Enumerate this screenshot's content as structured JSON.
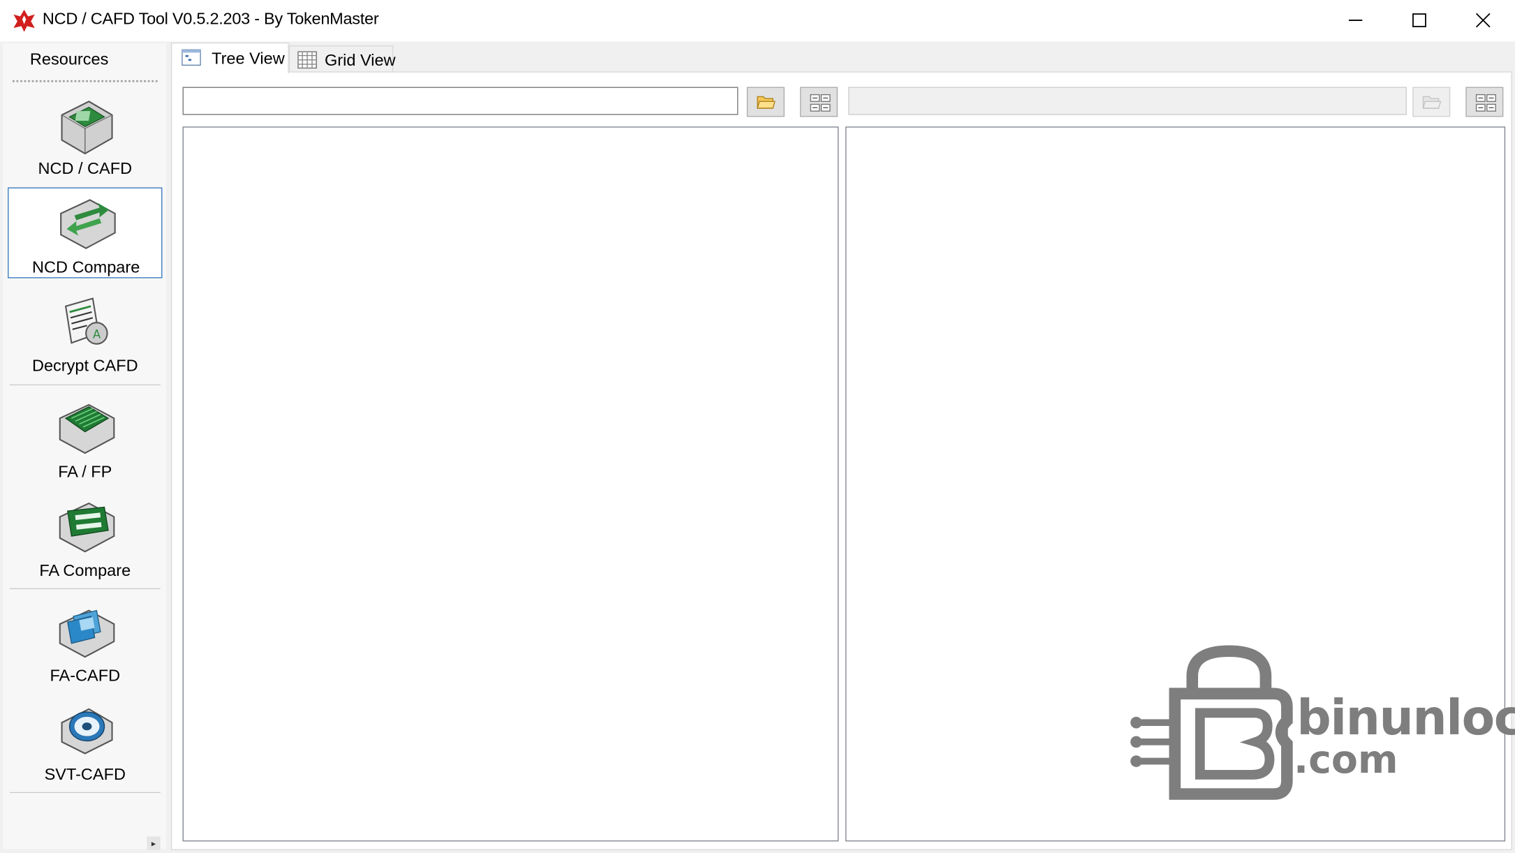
{
  "window": {
    "title": "NCD / CAFD Tool V0.5.2.203 - By TokenMaster",
    "controls": [
      "minimize-icon",
      "maximize-icon",
      "close-icon"
    ]
  },
  "sidebar": {
    "header": "Resources",
    "items": [
      {
        "label": "NCD / CAFD",
        "icon": "chip-icon",
        "selected": false
      },
      {
        "label": "NCD Compare",
        "icon": "compare-arrows-icon",
        "selected": true
      },
      {
        "label": "Decrypt CAFD",
        "icon": "decrypt-document-icon",
        "selected": false
      },
      {
        "label": "FA / FP",
        "icon": "green-board-icon",
        "selected": false
      },
      {
        "label": "FA Compare",
        "icon": "compare-list-icon",
        "selected": false
      },
      {
        "label": "FA-CAFD",
        "icon": "folders-icon",
        "selected": false
      },
      {
        "label": "SVT-CAFD",
        "icon": "disc-icon",
        "selected": false
      }
    ]
  },
  "tabs": [
    {
      "label": "Tree View",
      "icon": "tree-view-icon",
      "active": true
    },
    {
      "label": "Grid View",
      "icon": "grid-icon",
      "active": false
    }
  ],
  "toolbar": {
    "left_path_value": "",
    "right_path_value": "",
    "open_icon": "open-folder-icon",
    "compare_icon": "compare-list-icon"
  },
  "watermark": {
    "line1": "binunlock",
    "line2": ".com"
  },
  "colors": {
    "accent_selection": "#3b7bbf",
    "brand_red": "#d21e1e",
    "icon_green": "#2e8b3e"
  }
}
